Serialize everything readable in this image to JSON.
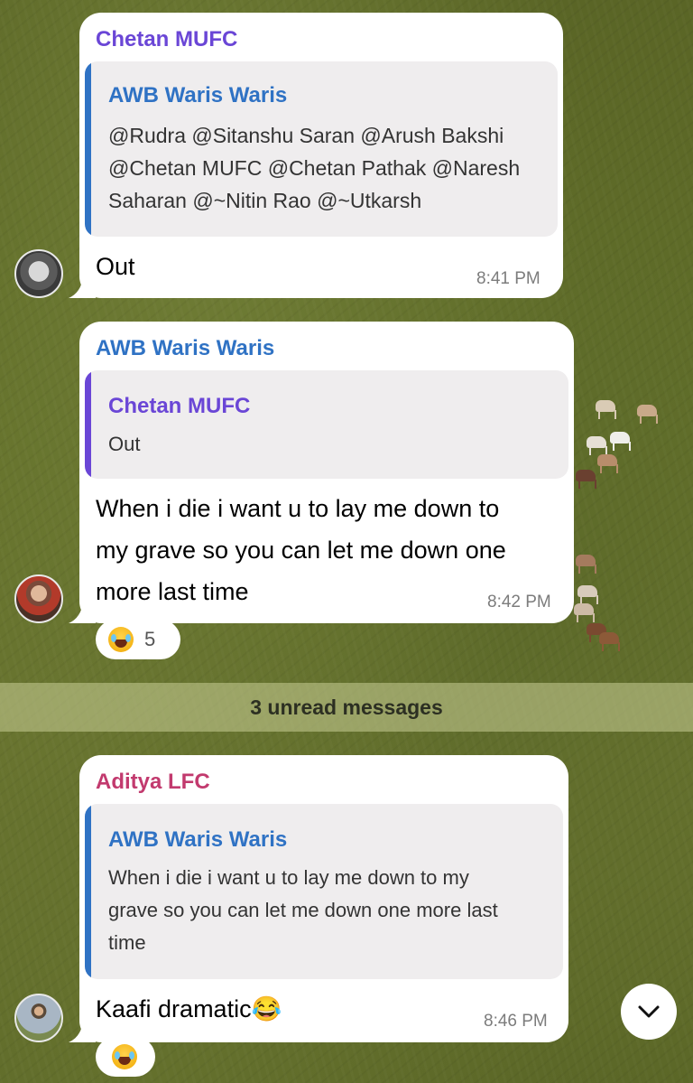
{
  "messages": [
    {
      "sender": "Chetan MUFC",
      "sender_color": "#6a46d6",
      "quote": {
        "name": "AWB Waris Waris",
        "name_color": "#2f72c4",
        "lines": [
          "@Rudra @Sitanshu Saran @Arush Bakshi",
          "@Chetan MUFC @Chetan Pathak @Naresh",
          "Saharan @~Nitin Rao @~Utkarsh"
        ]
      },
      "text_lines": [
        "Out"
      ],
      "time": "8:41 PM",
      "avatar": "husky-avatar"
    },
    {
      "sender": "AWB Waris Waris",
      "sender_color": "#2f72c4",
      "quote": {
        "name": "Chetan MUFC",
        "name_color": "#6a46d6",
        "lines": [
          "Out"
        ]
      },
      "text_lines": [
        "When i die i want u to lay me down to",
        "my grave so you can let me down one",
        "more last time"
      ],
      "time": "8:42 PM",
      "avatar": "man-avatar",
      "reaction": {
        "emoji": "joy-emoji",
        "count": "5"
      }
    },
    {
      "sender": "Aditya LFC",
      "sender_color": "#c23a6e",
      "quote": {
        "name": "AWB Waris Waris",
        "name_color": "#2f72c4",
        "lines": [
          "When i die i want u to lay me down to my",
          "grave so you can let me down one more last",
          "time"
        ]
      },
      "text_lines": [
        "Kaafi dramatic😂"
      ],
      "time": "8:46 PM",
      "avatar": "person-avatar",
      "reaction": {
        "emoji": "joy-emoji",
        "count": ""
      }
    }
  ],
  "unread_label": "3 unread messages",
  "scroll_down_icon": "chevron-down-icon"
}
